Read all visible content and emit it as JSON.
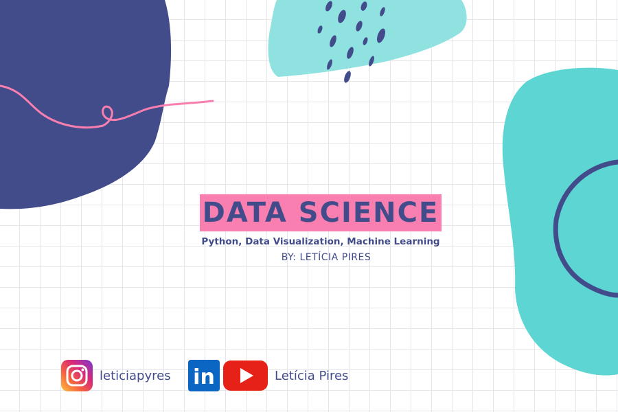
{
  "title": "DATA SCIENCE",
  "subtitle": "Python, Data Visualization, Machine Learning",
  "byline": "BY: LETÍCIA PIRES",
  "social": {
    "instagram": {
      "icon": "instagram-icon",
      "handle": "leticiapyres"
    },
    "linkedin": {
      "icon": "linkedin-icon",
      "label": "in"
    },
    "youtube": {
      "icon": "youtube-icon",
      "name": "Letícia Pires"
    }
  },
  "colors": {
    "navy": "#424c8b",
    "teal_dark": "#5cd5d3",
    "teal_light": "#8fe2e0",
    "pink": "#f87faf",
    "grid": "#e6e6ea"
  }
}
